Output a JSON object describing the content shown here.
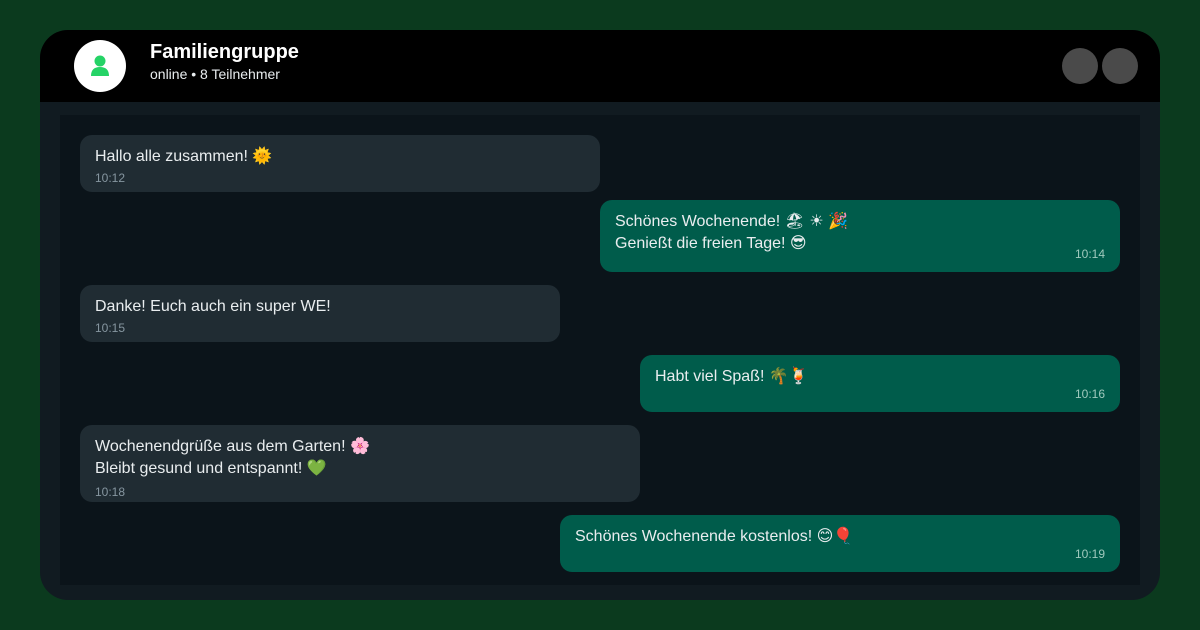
{
  "header": {
    "title": "Familiengruppe",
    "subtitle": "online • 8 Teilnehmer",
    "avatar_icon": "user-icon"
  },
  "colors": {
    "page_background": "#0b3a1e",
    "header_background": "#000000",
    "chat_background": "#0b141a",
    "incoming_bubble": "#202c33",
    "outgoing_bubble": "#005c4b",
    "avatar_accent": "#25d366"
  },
  "messages": [
    {
      "direction": "incoming",
      "lines": [
        "Hallo alle zusammen! 🌞"
      ],
      "time": "10:12"
    },
    {
      "direction": "outgoing",
      "lines": [
        "Schönes Wochenende! 🏖 ☀ 🎉",
        "Genießt die freien Tage! 😎"
      ],
      "time": "10:14"
    },
    {
      "direction": "incoming",
      "lines": [
        "Danke! Euch auch ein super WE!"
      ],
      "time": "10:15"
    },
    {
      "direction": "outgoing",
      "lines": [
        "Habt viel Spaß! 🌴🍹"
      ],
      "time": "10:16"
    },
    {
      "direction": "incoming",
      "lines": [
        "Wochenendgrüße aus dem Garten! 🌸",
        "Bleibt gesund und entspannt! 💚"
      ],
      "time": "10:18"
    },
    {
      "direction": "outgoing",
      "lines": [
        "Schönes Wochenende kostenlos! 😊🎈"
      ],
      "time": "10:19"
    }
  ]
}
